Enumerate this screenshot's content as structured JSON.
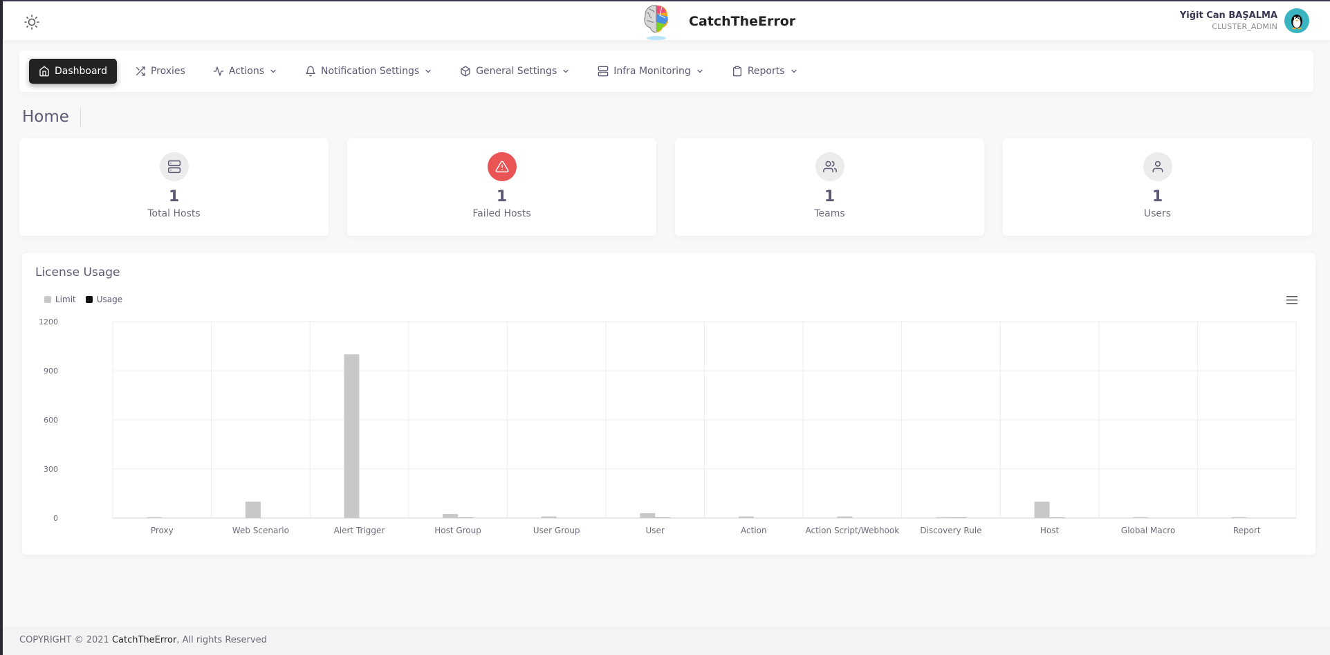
{
  "header": {
    "brand": "CatchTheError",
    "user_name": "Yiğit Can BAŞALMA",
    "user_role": "CLUSTER_ADMIN"
  },
  "nav": [
    {
      "label": "Dashboard",
      "icon": "home-icon",
      "active": true
    },
    {
      "label": "Proxies",
      "icon": "shuffle-icon",
      "active": false
    },
    {
      "label": "Actions",
      "icon": "activity-icon",
      "active": false
    },
    {
      "label": "Notification Settings",
      "icon": "bell-icon",
      "active": false
    },
    {
      "label": "General Settings",
      "icon": "box-icon",
      "active": false
    },
    {
      "label": "Infra Monitoring",
      "icon": "server-icon",
      "active": false
    },
    {
      "label": "Reports",
      "icon": "clipboard-icon",
      "active": false
    }
  ],
  "page_title": "Home",
  "stats": [
    {
      "value": "1",
      "label": "Total Hosts",
      "icon": "server-icon"
    },
    {
      "value": "1",
      "label": "Failed Hosts",
      "icon": "alert-triangle-icon"
    },
    {
      "value": "1",
      "label": "Teams",
      "icon": "users-icon"
    },
    {
      "value": "1",
      "label": "Users",
      "icon": "user-icon"
    }
  ],
  "chart_title": "License Usage",
  "colors": {
    "limit": "#c8c8c8",
    "usage": "#111111",
    "danger": "#ea5455"
  },
  "chart_data": {
    "type": "bar",
    "title": "License Usage",
    "categories": [
      "Proxy",
      "Web Scenario",
      "Alert Trigger",
      "Host Group",
      "User Group",
      "User",
      "Action",
      "Action Script/Webhook",
      "Discovery Rule",
      "Host",
      "Global Macro",
      "Report"
    ],
    "series": [
      {
        "name": "Limit",
        "values": [
          5,
          100,
          1000,
          25,
          10,
          30,
          10,
          10,
          5,
          100,
          5,
          5
        ]
      },
      {
        "name": "Usage",
        "values": [
          0,
          0,
          0,
          1,
          0,
          1,
          0,
          0,
          1,
          1,
          0,
          0
        ]
      }
    ],
    "yticks": [
      0,
      300,
      600,
      900,
      1200
    ],
    "ylim": [
      0,
      1200
    ],
    "grid": true,
    "legend_position": "top-left"
  },
  "footer": {
    "prefix": "COPYRIGHT © 2021 ",
    "brand": "CatchTheError",
    "suffix": ", All rights Reserved"
  }
}
